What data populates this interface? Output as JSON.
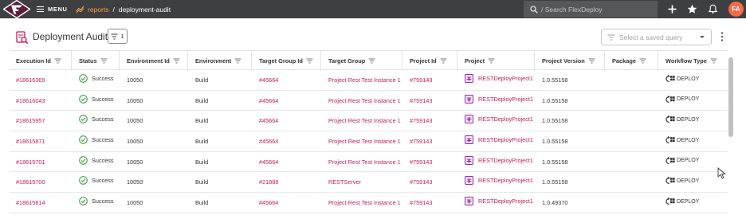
{
  "topbar": {
    "menu_label": "MENU",
    "breadcrumb_root": "reports",
    "breadcrumb_sep": "/",
    "breadcrumb_current": "deployment-audit",
    "search_placeholder": "/ Search FlexDeploy",
    "avatar_initials": "FA"
  },
  "header": {
    "title": "Deployment Audit",
    "filter_count": "1",
    "saved_query_placeholder": "Select a saved query"
  },
  "columns": [
    "Execution Id",
    "Status",
    "Environment Id",
    "Environment",
    "Target Group Id",
    "Target Group",
    "Project Id",
    "Project",
    "Project Version",
    "Package",
    "Workflow Type"
  ],
  "rows": [
    {
      "execution_id": "#18616369",
      "status": "Success",
      "environment_id": "10050",
      "environment": "Build",
      "target_group_id": "#45664",
      "target_group": "Project Rest Test Instance 1",
      "project_id": "#759143",
      "project": "RESTDeployProject1",
      "project_version": "1.0.55158",
      "package": "",
      "workflow_type": "DEPLOY"
    },
    {
      "execution_id": "#18616043",
      "status": "Success",
      "environment_id": "10050",
      "environment": "Build",
      "target_group_id": "#45664",
      "target_group": "Project Rest Test Instance 1",
      "project_id": "#759143",
      "project": "RESTDeployProject1",
      "project_version": "1.0.55158",
      "package": "",
      "workflow_type": "DEPLOY"
    },
    {
      "execution_id": "#18615957",
      "status": "Success",
      "environment_id": "10050",
      "environment": "Build",
      "target_group_id": "#45664",
      "target_group": "Project Rest Test Instance 1",
      "project_id": "#759143",
      "project": "RESTDeployProject1",
      "project_version": "1.0.55158",
      "package": "",
      "workflow_type": "DEPLOY"
    },
    {
      "execution_id": "#18615871",
      "status": "Success",
      "environment_id": "10050",
      "environment": "Build",
      "target_group_id": "#45664",
      "target_group": "Project Rest Test Instance 1",
      "project_id": "#759143",
      "project": "RESTDeployProject1",
      "project_version": "1.0.55158",
      "package": "",
      "workflow_type": "DEPLOY"
    },
    {
      "execution_id": "#18615701",
      "status": "Success",
      "environment_id": "10050",
      "environment": "Build",
      "target_group_id": "#45664",
      "target_group": "Project Rest Test Instance 1",
      "project_id": "#759143",
      "project": "RESTDeployProject1",
      "project_version": "1.0.55158",
      "package": "",
      "workflow_type": "DEPLOY"
    },
    {
      "execution_id": "#18615700",
      "status": "Success",
      "environment_id": "10050",
      "environment": "Build",
      "target_group_id": "#21888",
      "target_group": "RESTServer",
      "project_id": "#759143",
      "project": "RESTDeployProject1",
      "project_version": "1.0.55158",
      "package": "",
      "workflow_type": "DEPLOY"
    },
    {
      "execution_id": "#18615614",
      "status": "Success",
      "environment_id": "10050",
      "environment": "Build",
      "target_group_id": "#45664",
      "target_group": "Project Rest Test Instance 1",
      "project_id": "#759143",
      "project": "RESTDeployProject1",
      "project_version": "1.0.49370",
      "package": "",
      "workflow_type": "DEPLOY"
    }
  ],
  "icons": {
    "logo": "flexdeploy-logo",
    "reports": "reports-icon",
    "search": "search-icon",
    "add": "plus-icon",
    "favorites": "star-icon",
    "notifications": "bell-icon",
    "status": "check-circle-icon",
    "project": "project-icon",
    "workflow": "deploy-workflow-icon"
  },
  "colors": {
    "topbar": "#3d3f40",
    "link": "#c2185b",
    "success": "#43a047",
    "accent": "#f4a14b",
    "avatar": "#f26b4a",
    "project_icon": "#9c27b0"
  }
}
